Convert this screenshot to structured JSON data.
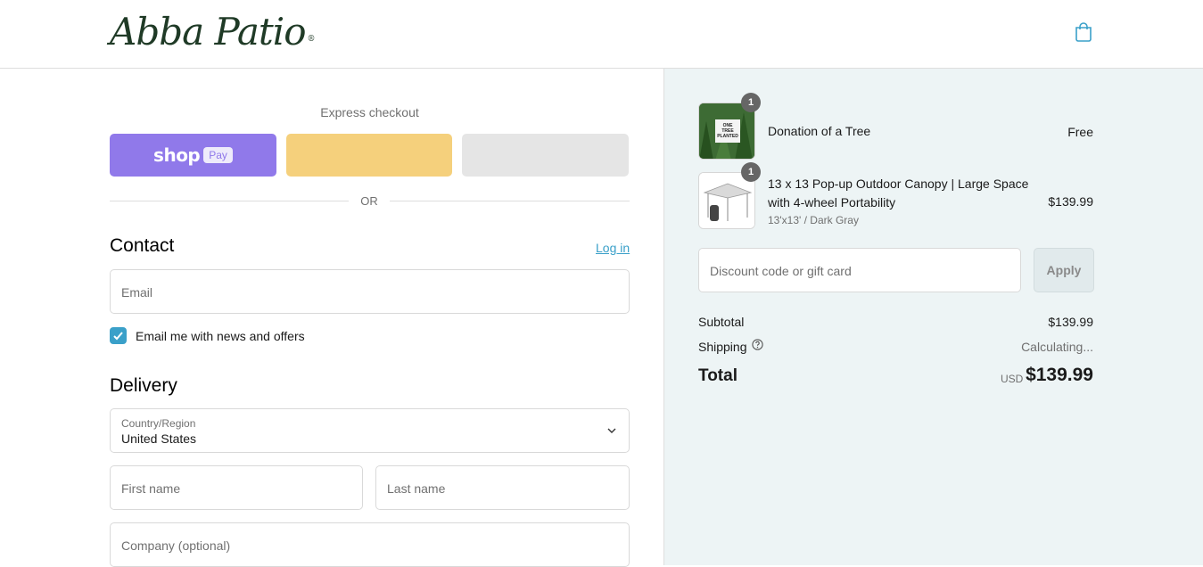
{
  "header": {
    "logo_text": "Abba Patio",
    "logo_reg": "®",
    "cart_icon": "shopping-bag-icon"
  },
  "express": {
    "label": "Express checkout",
    "shop_word": "shop",
    "shop_pay": "Pay",
    "or_text": "OR"
  },
  "contact": {
    "heading": "Contact",
    "login_link": "Log in",
    "email_placeholder": "Email",
    "newsletter_label": "Email me with news and offers",
    "newsletter_checked": true
  },
  "delivery": {
    "heading": "Delivery",
    "country_label": "Country/Region",
    "country_value": "United States",
    "first_name_placeholder": "First name",
    "last_name_placeholder": "Last name",
    "company_placeholder": "Company (optional)"
  },
  "summary": {
    "items": [
      {
        "title": "Donation of a Tree",
        "variant": "",
        "price": "Free",
        "qty": "1",
        "thumb_text": "ONE TREE PLANTED"
      },
      {
        "title_line1": "13 x 13 Pop-up Outdoor Canopy | Large Space",
        "title_line2": "with 4-wheel Portability",
        "variant": "13'x13' / Dark Gray",
        "price": "$139.99",
        "qty": "1"
      }
    ],
    "discount_placeholder": "Discount code or gift card",
    "apply_label": "Apply",
    "subtotal_label": "Subtotal",
    "subtotal_value": "$139.99",
    "shipping_label": "Shipping",
    "shipping_value": "Calculating...",
    "total_label": "Total",
    "total_currency": "USD",
    "total_value": "$139.99"
  },
  "colors": {
    "accent": "#3aa0c9",
    "shop_pay": "#9079ea",
    "paypal": "#f5d07c",
    "summary_bg": "#edf4f5"
  }
}
